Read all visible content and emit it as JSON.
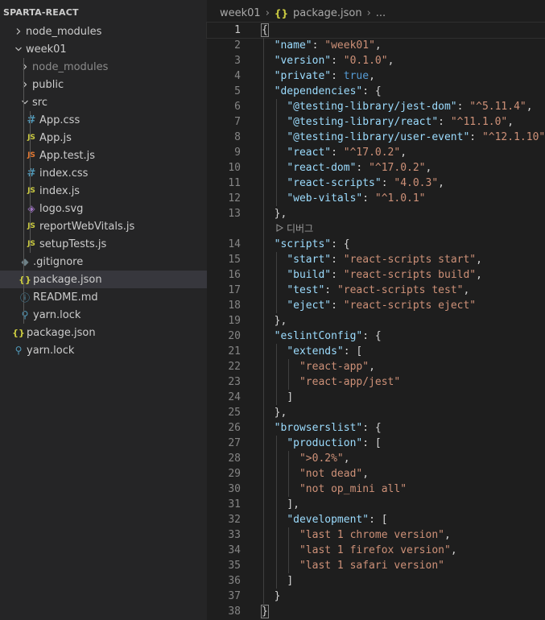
{
  "explorer": {
    "root_label": "SPARTA-REACT",
    "items": [
      {
        "label": "node_modules",
        "kind": "folder",
        "expanded": false,
        "depth": 1
      },
      {
        "label": "week01",
        "kind": "folder",
        "expanded": true,
        "depth": 1
      },
      {
        "label": "node_modules",
        "kind": "folder",
        "expanded": false,
        "depth": 2,
        "dimmed": true
      },
      {
        "label": "public",
        "kind": "folder",
        "expanded": false,
        "depth": 2
      },
      {
        "label": "src",
        "kind": "folder",
        "expanded": true,
        "depth": 2
      },
      {
        "label": "App.css",
        "kind": "css",
        "depth": 3
      },
      {
        "label": "App.js",
        "kind": "js",
        "depth": 3
      },
      {
        "label": "App.test.js",
        "kind": "test",
        "depth": 3
      },
      {
        "label": "index.css",
        "kind": "css",
        "depth": 3
      },
      {
        "label": "index.js",
        "kind": "js",
        "depth": 3
      },
      {
        "label": "logo.svg",
        "kind": "svg",
        "depth": 3
      },
      {
        "label": "reportWebVitals.js",
        "kind": "js",
        "depth": 3
      },
      {
        "label": "setupTests.js",
        "kind": "js",
        "depth": 3
      },
      {
        "label": ".gitignore",
        "kind": "git",
        "depth": 2
      },
      {
        "label": "package.json",
        "kind": "json",
        "depth": 2,
        "selected": true
      },
      {
        "label": "README.md",
        "kind": "info",
        "depth": 2
      },
      {
        "label": "yarn.lock",
        "kind": "yarn",
        "depth": 2
      },
      {
        "label": "package.json",
        "kind": "json",
        "depth": 1
      },
      {
        "label": "yarn.lock",
        "kind": "yarn",
        "depth": 1
      }
    ]
  },
  "icons": {
    "css": "#",
    "js": "JS",
    "test": "JS",
    "json": "{}",
    "info": "ⓘ",
    "git": "◆",
    "svg": "◈",
    "yarn": "⚲",
    "chevron_right": "chevron-right-icon",
    "chevron_down": "chevron-down-icon"
  },
  "colors": {
    "css": "#519aba",
    "js": "#cbcb41",
    "test": "#e37933",
    "json": "#cbcb41",
    "info": "#519aba",
    "git": "#6d8086",
    "svg": "#a074c4",
    "yarn": "#519aba"
  },
  "breadcrumb": {
    "folder": "week01",
    "file_icon": "{}",
    "file": "package.json",
    "more": "..."
  },
  "editor": {
    "current_line": 1,
    "codelens_text": "디버그",
    "lines": [
      {
        "n": "1",
        "indent": 0,
        "tokens": [
          {
            "t": "p",
            "v": "{"
          }
        ]
      },
      {
        "n": "2",
        "indent": 1,
        "tokens": [
          {
            "t": "k",
            "v": "\"name\""
          },
          {
            "t": "p",
            "v": ": "
          },
          {
            "t": "s",
            "v": "\"week01\""
          },
          {
            "t": "p",
            "v": ","
          }
        ]
      },
      {
        "n": "3",
        "indent": 1,
        "tokens": [
          {
            "t": "k",
            "v": "\"version\""
          },
          {
            "t": "p",
            "v": ": "
          },
          {
            "t": "s",
            "v": "\"0.1.0\""
          },
          {
            "t": "p",
            "v": ","
          }
        ]
      },
      {
        "n": "4",
        "indent": 1,
        "tokens": [
          {
            "t": "k",
            "v": "\"private\""
          },
          {
            "t": "p",
            "v": ": "
          },
          {
            "t": "b",
            "v": "true"
          },
          {
            "t": "p",
            "v": ","
          }
        ]
      },
      {
        "n": "5",
        "indent": 1,
        "tokens": [
          {
            "t": "k",
            "v": "\"dependencies\""
          },
          {
            "t": "p",
            "v": ": {"
          }
        ]
      },
      {
        "n": "6",
        "indent": 2,
        "tokens": [
          {
            "t": "k",
            "v": "\"@testing-library/jest-dom\""
          },
          {
            "t": "p",
            "v": ": "
          },
          {
            "t": "s",
            "v": "\"^5.11.4\""
          },
          {
            "t": "p",
            "v": ","
          }
        ]
      },
      {
        "n": "7",
        "indent": 2,
        "tokens": [
          {
            "t": "k",
            "v": "\"@testing-library/react\""
          },
          {
            "t": "p",
            "v": ": "
          },
          {
            "t": "s",
            "v": "\"^11.1.0\""
          },
          {
            "t": "p",
            "v": ","
          }
        ]
      },
      {
        "n": "8",
        "indent": 2,
        "tokens": [
          {
            "t": "k",
            "v": "\"@testing-library/user-event\""
          },
          {
            "t": "p",
            "v": ": "
          },
          {
            "t": "s",
            "v": "\"^12.1.10\""
          },
          {
            "t": "p",
            "v": ","
          }
        ]
      },
      {
        "n": "9",
        "indent": 2,
        "tokens": [
          {
            "t": "k",
            "v": "\"react\""
          },
          {
            "t": "p",
            "v": ": "
          },
          {
            "t": "s",
            "v": "\"^17.0.2\""
          },
          {
            "t": "p",
            "v": ","
          }
        ]
      },
      {
        "n": "10",
        "indent": 2,
        "tokens": [
          {
            "t": "k",
            "v": "\"react-dom\""
          },
          {
            "t": "p",
            "v": ": "
          },
          {
            "t": "s",
            "v": "\"^17.0.2\""
          },
          {
            "t": "p",
            "v": ","
          }
        ]
      },
      {
        "n": "11",
        "indent": 2,
        "tokens": [
          {
            "t": "k",
            "v": "\"react-scripts\""
          },
          {
            "t": "p",
            "v": ": "
          },
          {
            "t": "s",
            "v": "\"4.0.3\""
          },
          {
            "t": "p",
            "v": ","
          }
        ]
      },
      {
        "n": "12",
        "indent": 2,
        "tokens": [
          {
            "t": "k",
            "v": "\"web-vitals\""
          },
          {
            "t": "p",
            "v": ": "
          },
          {
            "t": "s",
            "v": "\"^1.0.1\""
          }
        ]
      },
      {
        "n": "13",
        "indent": 1,
        "tokens": [
          {
            "t": "p",
            "v": "},"
          }
        ]
      },
      {
        "n": "14",
        "indent": 1,
        "tokens": [
          {
            "t": "k",
            "v": "\"scripts\""
          },
          {
            "t": "p",
            "v": ": {"
          }
        ]
      },
      {
        "n": "15",
        "indent": 2,
        "tokens": [
          {
            "t": "k",
            "v": "\"start\""
          },
          {
            "t": "p",
            "v": ": "
          },
          {
            "t": "s",
            "v": "\"react-scripts start\""
          },
          {
            "t": "p",
            "v": ","
          }
        ]
      },
      {
        "n": "16",
        "indent": 2,
        "tokens": [
          {
            "t": "k",
            "v": "\"build\""
          },
          {
            "t": "p",
            "v": ": "
          },
          {
            "t": "s",
            "v": "\"react-scripts build\""
          },
          {
            "t": "p",
            "v": ","
          }
        ]
      },
      {
        "n": "17",
        "indent": 2,
        "tokens": [
          {
            "t": "k",
            "v": "\"test\""
          },
          {
            "t": "p",
            "v": ": "
          },
          {
            "t": "s",
            "v": "\"react-scripts test\""
          },
          {
            "t": "p",
            "v": ","
          }
        ]
      },
      {
        "n": "18",
        "indent": 2,
        "tokens": [
          {
            "t": "k",
            "v": "\"eject\""
          },
          {
            "t": "p",
            "v": ": "
          },
          {
            "t": "s",
            "v": "\"react-scripts eject\""
          }
        ]
      },
      {
        "n": "19",
        "indent": 1,
        "tokens": [
          {
            "t": "p",
            "v": "},"
          }
        ]
      },
      {
        "n": "20",
        "indent": 1,
        "tokens": [
          {
            "t": "k",
            "v": "\"eslintConfig\""
          },
          {
            "t": "p",
            "v": ": {"
          }
        ]
      },
      {
        "n": "21",
        "indent": 2,
        "tokens": [
          {
            "t": "k",
            "v": "\"extends\""
          },
          {
            "t": "p",
            "v": ": ["
          }
        ]
      },
      {
        "n": "22",
        "indent": 3,
        "tokens": [
          {
            "t": "s",
            "v": "\"react-app\""
          },
          {
            "t": "p",
            "v": ","
          }
        ]
      },
      {
        "n": "23",
        "indent": 3,
        "tokens": [
          {
            "t": "s",
            "v": "\"react-app/jest\""
          }
        ]
      },
      {
        "n": "24",
        "indent": 2,
        "tokens": [
          {
            "t": "p",
            "v": "]"
          }
        ]
      },
      {
        "n": "25",
        "indent": 1,
        "tokens": [
          {
            "t": "p",
            "v": "},"
          }
        ]
      },
      {
        "n": "26",
        "indent": 1,
        "tokens": [
          {
            "t": "k",
            "v": "\"browserslist\""
          },
          {
            "t": "p",
            "v": ": {"
          }
        ]
      },
      {
        "n": "27",
        "indent": 2,
        "tokens": [
          {
            "t": "k",
            "v": "\"production\""
          },
          {
            "t": "p",
            "v": ": ["
          }
        ]
      },
      {
        "n": "28",
        "indent": 3,
        "tokens": [
          {
            "t": "s",
            "v": "\">0.2%\""
          },
          {
            "t": "p",
            "v": ","
          }
        ]
      },
      {
        "n": "29",
        "indent": 3,
        "tokens": [
          {
            "t": "s",
            "v": "\"not dead\""
          },
          {
            "t": "p",
            "v": ","
          }
        ]
      },
      {
        "n": "30",
        "indent": 3,
        "tokens": [
          {
            "t": "s",
            "v": "\"not op_mini all\""
          }
        ]
      },
      {
        "n": "31",
        "indent": 2,
        "tokens": [
          {
            "t": "p",
            "v": "],"
          }
        ]
      },
      {
        "n": "32",
        "indent": 2,
        "tokens": [
          {
            "t": "k",
            "v": "\"development\""
          },
          {
            "t": "p",
            "v": ": ["
          }
        ]
      },
      {
        "n": "33",
        "indent": 3,
        "tokens": [
          {
            "t": "s",
            "v": "\"last 1 chrome version\""
          },
          {
            "t": "p",
            "v": ","
          }
        ]
      },
      {
        "n": "34",
        "indent": 3,
        "tokens": [
          {
            "t": "s",
            "v": "\"last 1 firefox version\""
          },
          {
            "t": "p",
            "v": ","
          }
        ]
      },
      {
        "n": "35",
        "indent": 3,
        "tokens": [
          {
            "t": "s",
            "v": "\"last 1 safari version\""
          }
        ]
      },
      {
        "n": "36",
        "indent": 2,
        "tokens": [
          {
            "t": "p",
            "v": "]"
          }
        ]
      },
      {
        "n": "37",
        "indent": 1,
        "tokens": [
          {
            "t": "p",
            "v": "}"
          }
        ]
      },
      {
        "n": "38",
        "indent": 0,
        "tokens": [
          {
            "t": "p",
            "v": "}"
          }
        ]
      }
    ]
  }
}
